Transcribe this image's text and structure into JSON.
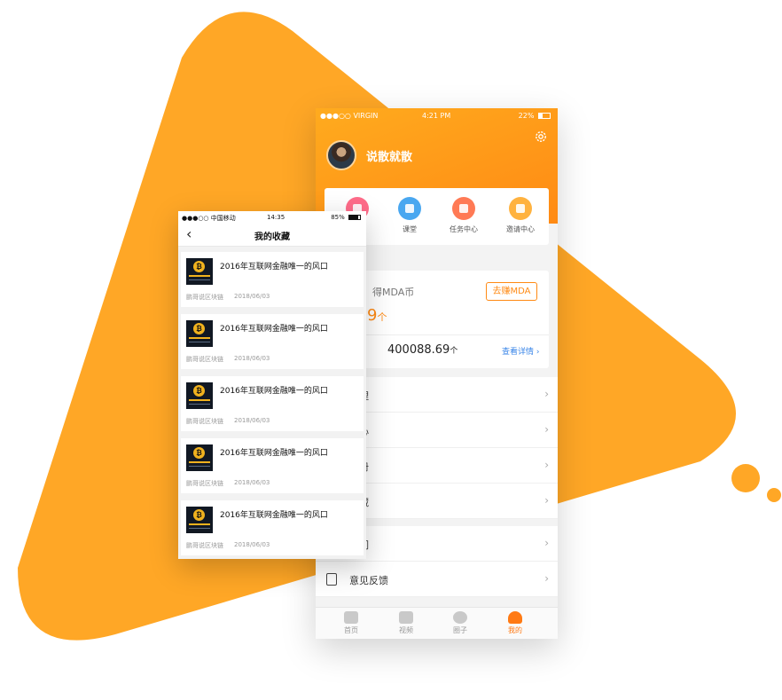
{
  "colors": {
    "accent": "#ffa726",
    "orange": "#ff8a14",
    "link": "#3a86e8"
  },
  "back_phone": {
    "status": {
      "carrier": "●●●○○ VIRGIN",
      "time": "4:21 PM",
      "battery": "22%"
    },
    "username": "说散就散",
    "quick_items": [
      {
        "label": "",
        "color": "#ff6c8a"
      },
      {
        "label": "课堂",
        "color": "#49a7f0"
      },
      {
        "label": "任务中心",
        "color": "#ff7a55"
      },
      {
        "label": "邀请中心",
        "color": "#ffb23f"
      }
    ],
    "card": {
      "label": "得MDA币",
      "amount": "9",
      "amount_unit": "个",
      "earn_button": "去赚MDA",
      "total": "400088.69",
      "total_unit": "个",
      "details_link": "查看详情 ›"
    },
    "menu_group1": [
      "管理",
      "中心",
      "手册",
      "收藏"
    ],
    "menu_group2": [
      "我们",
      "意见反馈"
    ],
    "tabs": [
      "首页",
      "视频",
      "圈子",
      "我的"
    ]
  },
  "front_phone": {
    "status": {
      "carrier": "●●●○○ 中国移动",
      "time": "14:35",
      "battery": "85%"
    },
    "back_icon": "‹",
    "title": "我的收藏",
    "items": [
      {
        "title": "2016年互联网金融唯一的风口",
        "source": "鹏哥说区块链",
        "date": "2018/06/03"
      },
      {
        "title": "2016年互联网金融唯一的风口",
        "source": "鹏哥说区块链",
        "date": "2018/06/03"
      },
      {
        "title": "2016年互联网金融唯一的风口",
        "source": "鹏哥说区块链",
        "date": "2018/06/03"
      },
      {
        "title": "2016年互联网金融唯一的风口",
        "source": "鹏哥说区块链",
        "date": "2018/06/03"
      },
      {
        "title": "2016年互联网金融唯一的风口",
        "source": "鹏哥说区块链",
        "date": "2018/06/03"
      }
    ]
  }
}
